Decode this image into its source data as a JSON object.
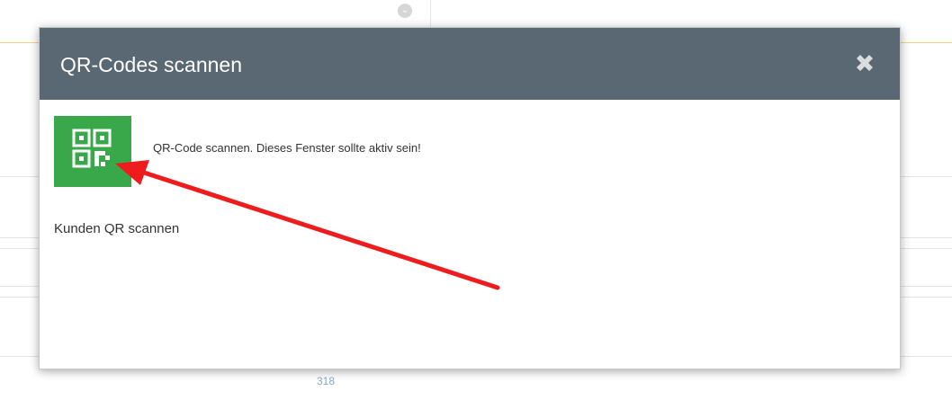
{
  "background": {
    "footer_number": "318",
    "yellow_line_color": "#f3d27a"
  },
  "modal": {
    "title": "QR-Codes scannen",
    "header_color": "#5a6874",
    "close_icon": "close-x-icon",
    "scan_button": {
      "icon": "qr-code-icon",
      "color": "#38a84a"
    },
    "hint": "QR-Code scannen. Dieses Fenster sollte aktiv sein!",
    "customer_label": "Kunden QR scannen"
  },
  "annotation": {
    "arrow_color": "#ee1c1c",
    "arrow_icon": "red-arrow-annotation"
  }
}
